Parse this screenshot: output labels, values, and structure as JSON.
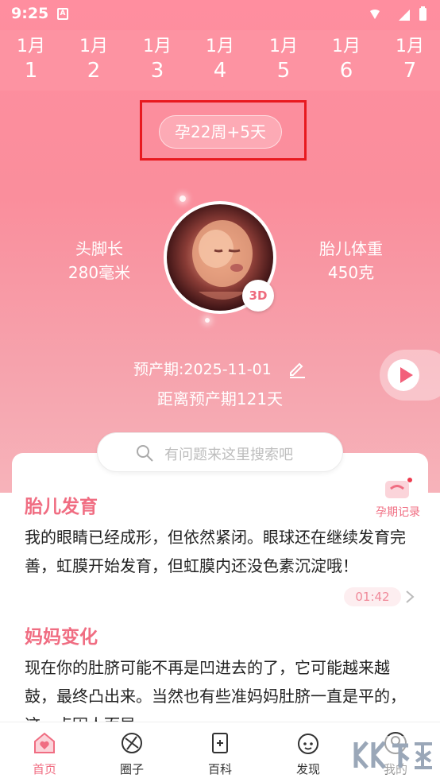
{
  "status_bar": {
    "time": "9:25",
    "a_icon": "A"
  },
  "dates": [
    {
      "month": "1月",
      "day": "1"
    },
    {
      "month": "1月",
      "day": "2"
    },
    {
      "month": "1月",
      "day": "3"
    },
    {
      "month": "1月",
      "day": "4"
    },
    {
      "month": "1月",
      "day": "5"
    },
    {
      "month": "1月",
      "day": "6"
    },
    {
      "month": "1月",
      "day": "7"
    }
  ],
  "week": "孕22周+5天",
  "stats": {
    "length_label": "头脚长",
    "length_value": "280毫米",
    "weight_label": "胎儿体重",
    "weight_value": "450克"
  },
  "badge_3d": "3D",
  "due_date": "预产期:2025-11-01",
  "countdown": "距离预产期121天",
  "search": {
    "placeholder": "有问题来这里搜索吧"
  },
  "record": {
    "label": "孕期记录"
  },
  "sections": {
    "fetal_title": "胎儿发育",
    "fetal_text": "我的眼睛已经成形，但依然紧闭。眼球还在继续发育完善，虹膜开始发育，但虹膜内还没色素沉淀哦！",
    "duration": "01:42",
    "mom_title": "妈妈变化",
    "mom_text": "现在你的肚脐可能不再是凹进去的了，它可能越来越鼓，最终凸出来。当然也有些准妈妈肚脐一直是平的，这一点因人而异。"
  },
  "nav": [
    {
      "label": "首页",
      "icon": "home-heart-icon",
      "active": true
    },
    {
      "label": "圈子",
      "icon": "circle-icon",
      "active": false
    },
    {
      "label": "百科",
      "icon": "encyclopedia-icon",
      "active": false
    },
    {
      "label": "发现",
      "icon": "discover-icon",
      "active": false
    },
    {
      "label": "我的",
      "icon": "profile-icon",
      "active": false
    }
  ],
  "watermark": "KK下载",
  "colors": {
    "accent": "#f06d82",
    "hero_top": "#ff8e9f",
    "highlight_box": "#e8191f"
  }
}
